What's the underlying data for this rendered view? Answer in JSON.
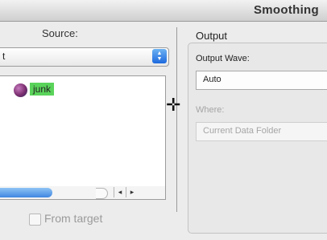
{
  "window": {
    "title": "Smoothing"
  },
  "source": {
    "label": "Source:",
    "selected": "t",
    "waves": [
      {
        "name": "junk",
        "icon": "wave-icon"
      }
    ],
    "scroll_left_arrow": "◂",
    "scroll_right_arrow": "▸"
  },
  "output": {
    "label": "Output",
    "output_wave_label": "Output Wave:",
    "output_wave_value": "Auto",
    "where_label": "Where:",
    "where_value": "Current Data Folder"
  },
  "from_target": {
    "label": "From target",
    "checked": false
  }
}
